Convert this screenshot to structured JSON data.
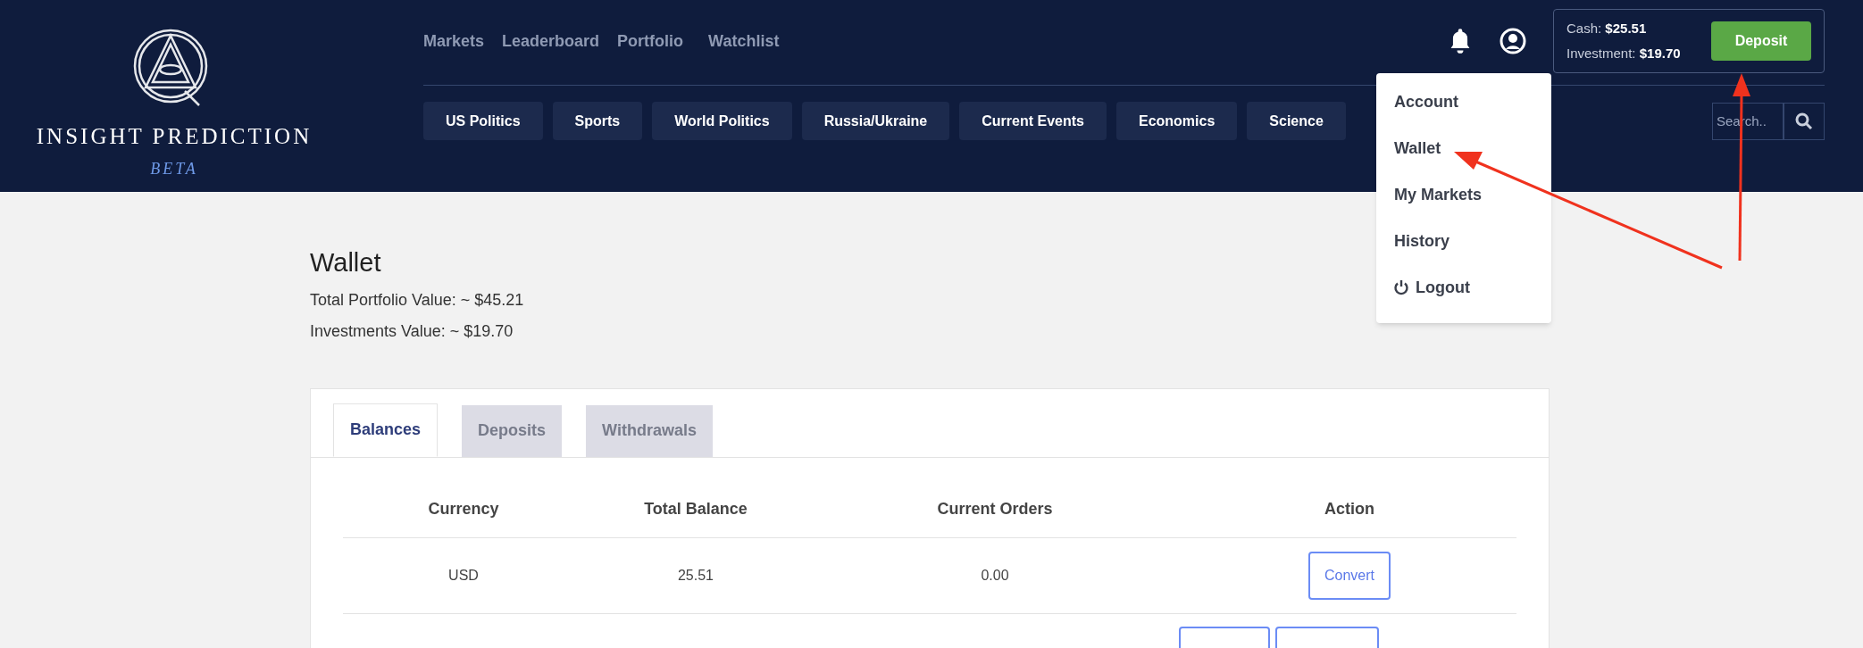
{
  "logo": {
    "name": "INSIGHT PREDICTION",
    "tagline": "BETA"
  },
  "nav": [
    {
      "label": "Markets"
    },
    {
      "label": "Leaderboard"
    },
    {
      "label": "Portfolio"
    },
    {
      "label": "Watchlist"
    }
  ],
  "account_box": {
    "cash_label": "Cash:",
    "cash": "$25.51",
    "investment_label": "Investment:",
    "investment": "$19.70",
    "deposit_button": "Deposit"
  },
  "categories": [
    {
      "label": "US Politics"
    },
    {
      "label": "Sports"
    },
    {
      "label": "World Politics"
    },
    {
      "label": "Russia/Ukraine"
    },
    {
      "label": "Current Events"
    },
    {
      "label": "Economics"
    },
    {
      "label": "Science"
    }
  ],
  "search": {
    "placeholder": "Search.."
  },
  "user_menu": {
    "expanded": true,
    "items": [
      {
        "label": "Account",
        "kind": "link"
      },
      {
        "label": "Wallet",
        "kind": "link"
      },
      {
        "label": "My Markets",
        "kind": "link"
      },
      {
        "label": "History",
        "kind": "link"
      },
      {
        "label": "Logout",
        "kind": "logout"
      }
    ]
  },
  "page": {
    "title": "Wallet",
    "lines": [
      "Total Portfolio Value: ~ $45.21",
      "Investments Value: ~ $19.70"
    ]
  },
  "tabs": [
    {
      "label": "Balances",
      "selected": true
    },
    {
      "label": "Deposits",
      "selected": false
    },
    {
      "label": "Withdrawals",
      "selected": false
    }
  ],
  "table": {
    "columns": [
      "Currency",
      "Total Balance",
      "Current Orders",
      "Action"
    ],
    "rows": [
      {
        "cells": [
          "USD",
          "25.51",
          "0.00"
        ],
        "actions": [
          "Convert"
        ]
      }
    ],
    "cut_off_row": {
      "buttons": [
        {
          "kind": "outline"
        },
        {
          "kind": "outline"
        }
      ]
    }
  },
  "annotations": [
    {
      "kind": "arrow"
    },
    {
      "kind": "arrow"
    }
  ]
}
